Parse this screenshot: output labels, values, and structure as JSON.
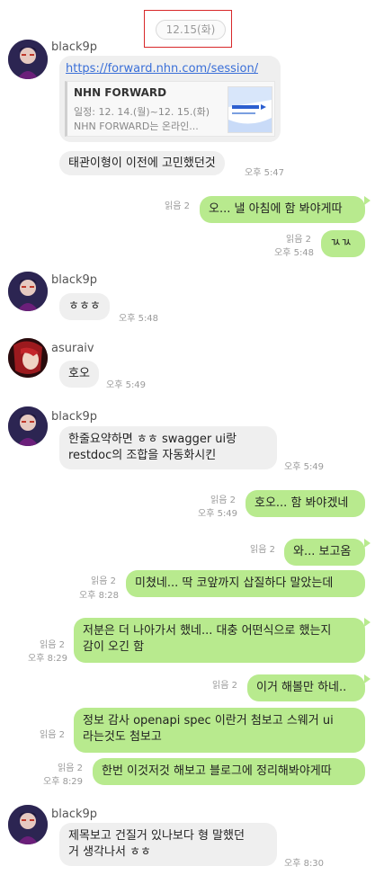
{
  "date_divider": "12.15(화)",
  "messages": [
    {
      "sender": "black9p",
      "link_url": "https://forward.nhn.com/session/3",
      "card_title": "NHN FORWARD",
      "card_date": "일정: 12. 14.(월)~12. 15.(화)",
      "card_desc": "NHN FORWARD는 온라인..."
    },
    {
      "text": "태관이형이 이전에 고민했던것",
      "time": "오후 5:47"
    },
    {
      "read": "읽음 2",
      "text": "오... 낼 아침에 함 봐야게따"
    },
    {
      "read": "읽음 2",
      "time": "오후 5:48",
      "text": "ㄳㄳ"
    },
    {
      "sender": "black9p",
      "text": "ㅎㅎㅎ",
      "time": "오후 5:48"
    },
    {
      "sender": "asuraiv",
      "text": "호오",
      "time": "오후 5:49"
    },
    {
      "sender": "black9p",
      "line1": "한줄요약하면 ㅎㅎ swagger ui랑",
      "line2": "restdoc의 조합을 자동화시킨",
      "time": "오후 5:49"
    },
    {
      "read": "읽음 2",
      "time": "오후 5:49",
      "text": "호오... 함 봐야겠네"
    },
    {
      "read": "읽음 2",
      "text": "와... 보고옴"
    },
    {
      "read": "읽음 2",
      "time": "오후 8:28",
      "text": "미쳤네...  딱 코앞까지 삽질하다 말았는데"
    },
    {
      "read": "읽음 2",
      "time": "오후 8:29",
      "line1": "저분은 더 나아가서 했네... 대충 어떤식으로 했는지",
      "line2": "감이 오긴 함"
    },
    {
      "read": "읽음 2",
      "text": "이거 해볼만 하네.."
    },
    {
      "read": "읽음 2",
      "line1": "정보 감사 openapi spec 이란거 첨보고  스웨거 ui",
      "line2": "라는것도 첨보고"
    },
    {
      "read": "읽음 2",
      "time": "오후 8:29",
      "text": "한번 이것저것 해보고 블로그에 정리해봐야게따"
    },
    {
      "sender": "black9p",
      "line1": "제목보고 건질거 있나보다 형 말했던",
      "line2": "거 생각나서 ㅎㅎ",
      "time": "오후 8:30"
    }
  ],
  "colors": {
    "mine": "#b8ea8e",
    "theirs": "#efefef",
    "link": "#3a6fd8",
    "highlight": "#d8282a"
  }
}
